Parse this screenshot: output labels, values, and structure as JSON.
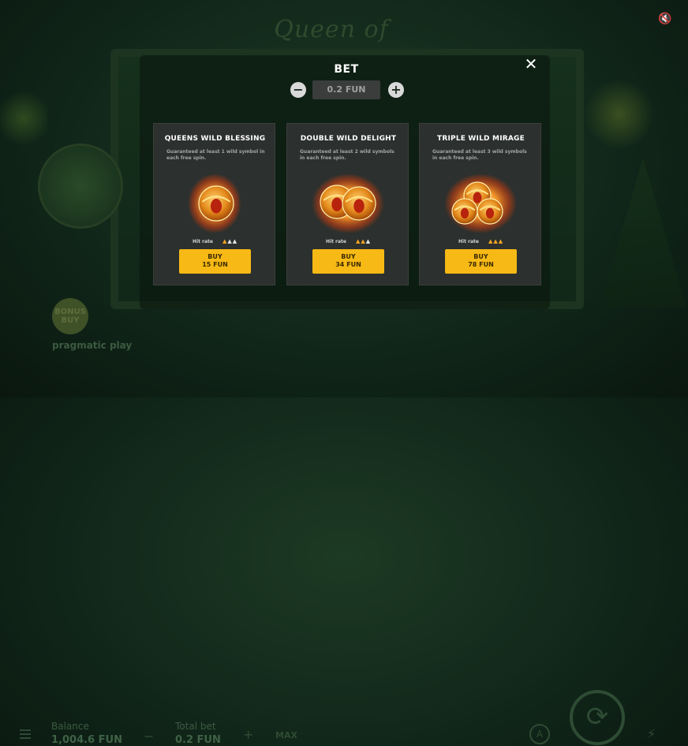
{
  "game": {
    "title": "Queen of the Nile",
    "logo_text": "pragmatic play",
    "bonus_buy_badge": "BONUS BUY",
    "balance_label": "Balance",
    "balance_value": "1,004.6 FUN",
    "total_bet_label": "Total bet",
    "total_bet_value": "0.2 FUN",
    "max_label": "MAX",
    "auto_label": "A"
  },
  "modal": {
    "title": "BET",
    "bet_value": "0.2 FUN",
    "close_icon": "close-icon",
    "minus_icon": "minus-icon",
    "plus_icon": "plus-icon"
  },
  "offers": [
    {
      "title": "QUEENS WILD BLESSING",
      "description": "Guaranteed at least 1 wild symbol in each free spin.",
      "hit_rate_label": "Hit rate",
      "hit_rate_level": 1,
      "hit_rate_max": 3,
      "buy_label": "BUY",
      "price": "15 FUN",
      "coins": 1
    },
    {
      "title": "DOUBLE WILD DELIGHT",
      "description": "Guaranteed at least 2 wild symbols in each free spin.",
      "hit_rate_label": "Hit rate",
      "hit_rate_level": 2,
      "hit_rate_max": 3,
      "buy_label": "BUY",
      "price": "34 FUN",
      "coins": 2
    },
    {
      "title": "TRIPLE WILD MIRAGE",
      "description": "Guaranteed at least 3 wild symbols in each free spin.",
      "hit_rate_label": "Hit rate",
      "hit_rate_level": 3,
      "hit_rate_max": 3,
      "buy_label": "BUY",
      "price": "78 FUN",
      "coins": 3
    }
  ],
  "colors": {
    "buy_button": "#f7b915",
    "card_bg": "#2c302e",
    "drop_active": "#f5a623",
    "drop_inactive": "#e6e6e6"
  }
}
